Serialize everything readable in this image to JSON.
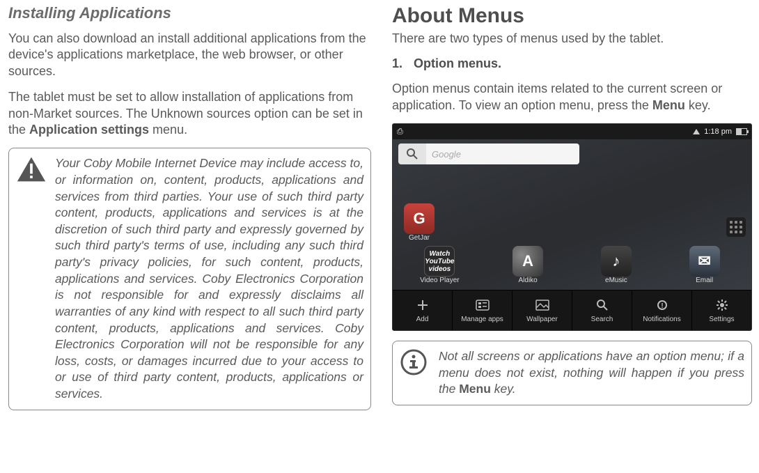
{
  "left": {
    "title": "Installing Applications",
    "p1": "You can also download an install additional applications from the device's applications marketplace, the web browser, or other sources.",
    "p2_a": "The tablet must be set to allow installation of applications from non-Market sources. The Unknown sources option can be set in the ",
    "p2_bold": "Application settings",
    "p2_b": " menu.",
    "notice": "Your Coby Mobile Internet Device may include access to, or information on, content, products, applications and services from third parties. Your use of such third party content, products, applications and services is at the discretion of such third party and expressly governed by such third party's terms of use, including any such third party's privacy policies, for such content, products, applications and services. Coby Electronics Corporation is not responsible for and expressly disclaims all warranties of any kind with respect to all such third party content, products, applications and services. Coby Electronics Corporation will not be responsible for any loss, costs, or damages incurred due to your access to or use of third party content, products, applications or services."
  },
  "right": {
    "title": "About Menus",
    "intro": "There are two types of menus used by the tablet.",
    "item1_num": "1.",
    "item1_label": "Option menus.",
    "p_a": "Option menus contain items related to the current screen or application. To view an option menu, press the ",
    "p_bold": "Menu",
    "p_b": " key.",
    "info_a": "Not all screens or applications have an option menu; if a menu does not exist, nothing will happen if you press the ",
    "info_bold": "Menu",
    "info_b": " key."
  },
  "screenshot": {
    "time": "1:18 pm",
    "search_placeholder": "Google",
    "apps": {
      "getjar": "GetJar",
      "video_player": "Video Player",
      "video_player_icon_text": "Watch YouTube videos",
      "aldiko": "Aldiko",
      "emusic": "eMusic",
      "email": "Email"
    },
    "menu": [
      "Add",
      "Manage apps",
      "Wallpaper",
      "Search",
      "Notifications",
      "Settings"
    ]
  }
}
